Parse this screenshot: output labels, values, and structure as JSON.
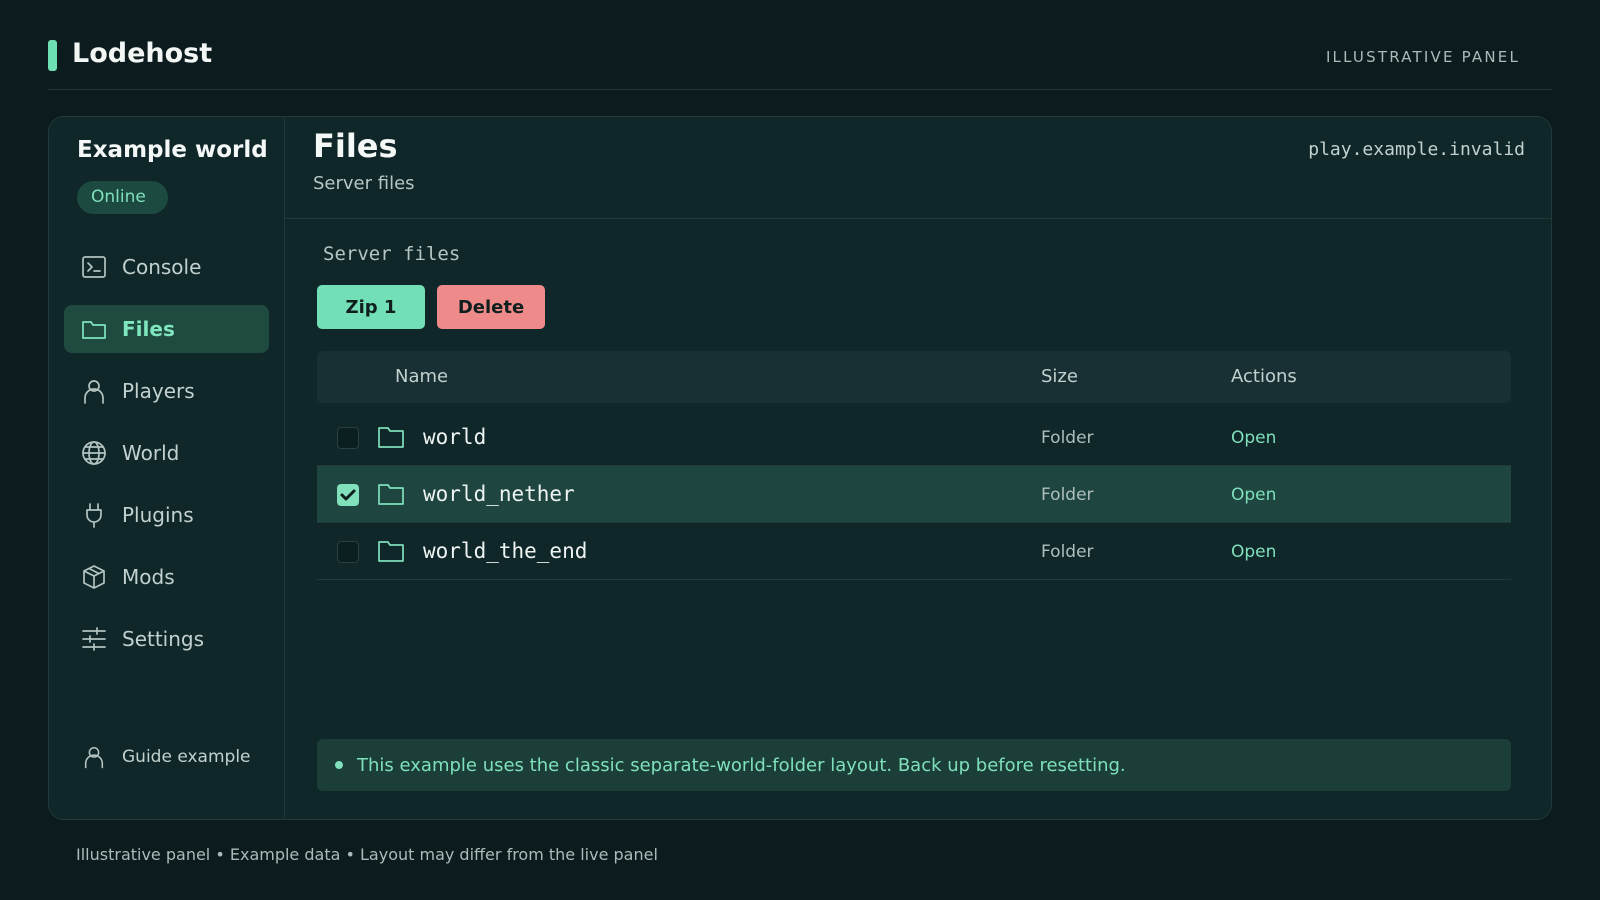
{
  "app": {
    "name": "Lodehost",
    "tag": "ILLUSTRATIVE PANEL"
  },
  "server": {
    "name": "Example world",
    "status": "Online",
    "host": "play.example.invalid"
  },
  "nav": [
    {
      "label": "Console",
      "icon": "terminal-icon"
    },
    {
      "label": "Files",
      "icon": "folder-icon",
      "active": true
    },
    {
      "label": "Players",
      "icon": "user-icon"
    },
    {
      "label": "World",
      "icon": "globe-icon"
    },
    {
      "label": "Plugins",
      "icon": "plug-icon"
    },
    {
      "label": "Mods",
      "icon": "cube-icon"
    },
    {
      "label": "Settings",
      "icon": "sliders-icon"
    }
  ],
  "guide": {
    "label": "Guide example",
    "icon": "user-icon"
  },
  "page": {
    "title": "Files",
    "subtitle": "Server files",
    "section_label": "Server files"
  },
  "toolbar": {
    "zip_label": "Zip 1",
    "delete_label": "Delete"
  },
  "table": {
    "headers": {
      "name": "Name",
      "size": "Size",
      "actions": "Actions"
    },
    "rows": [
      {
        "name": "world",
        "size": "Folder",
        "action": "Open",
        "selected": false
      },
      {
        "name": "world_nether",
        "size": "Folder",
        "action": "Open",
        "selected": true
      },
      {
        "name": "world_the_end",
        "size": "Folder",
        "action": "Open",
        "selected": false
      }
    ]
  },
  "notice": "This example uses the classic separate-world-folder layout. Back up before resetting.",
  "footer": "Illustrative panel • Example data • Layout may differ from the live panel",
  "colors": {
    "accent": "#6ee0b4",
    "danger": "#ef8a8a",
    "background": "#0c1b1d",
    "panel": "#10272a"
  }
}
